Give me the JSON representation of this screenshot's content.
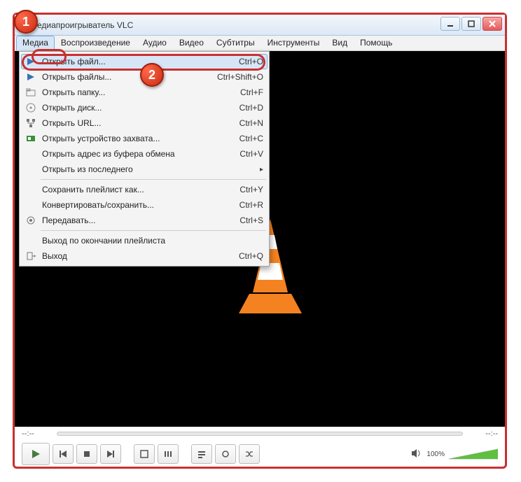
{
  "window": {
    "title": "едиапроигрыватель VLC"
  },
  "badges": {
    "one": "1",
    "two": "2"
  },
  "menubar": {
    "items": [
      "Медиа",
      "Воспроизведение",
      "Аудио",
      "Видео",
      "Субтитры",
      "Инструменты",
      "Вид",
      "Помощь"
    ]
  },
  "dropdown": {
    "items": [
      {
        "icon": "play-file-icon",
        "label": "Открыть файл...",
        "shortcut": "Ctrl+O",
        "highlight": true
      },
      {
        "icon": "play-multi-icon",
        "label": "Открыть файлы...",
        "shortcut": "Ctrl+Shift+O"
      },
      {
        "icon": "folder-icon",
        "label": "Открыть папку...",
        "shortcut": "Ctrl+F"
      },
      {
        "icon": "disc-icon",
        "label": "Открыть диск...",
        "shortcut": "Ctrl+D"
      },
      {
        "icon": "network-icon",
        "label": "Открыть URL...",
        "shortcut": "Ctrl+N"
      },
      {
        "icon": "capture-icon",
        "label": "Открыть устройство захвата...",
        "shortcut": "Ctrl+C"
      },
      {
        "icon": "clipboard-icon",
        "label": "Открыть адрес из буфера обмена",
        "shortcut": "Ctrl+V"
      },
      {
        "icon": "recent-icon",
        "label": "Открыть из последнего",
        "shortcut": "",
        "submenu": true
      },
      {
        "sep": true
      },
      {
        "icon": "save-icon",
        "label": "Сохранить плейлист как...",
        "shortcut": "Ctrl+Y"
      },
      {
        "icon": "convert-icon",
        "label": "Конвертировать/сохранить...",
        "shortcut": "Ctrl+R"
      },
      {
        "icon": "stream-icon",
        "label": "Передавать...",
        "shortcut": "Ctrl+S"
      },
      {
        "sep": true
      },
      {
        "icon": "quit-end-icon",
        "label": "Выход по окончании плейлиста",
        "shortcut": ""
      },
      {
        "icon": "exit-icon",
        "label": "Выход",
        "shortcut": "Ctrl+Q"
      }
    ]
  },
  "playback": {
    "time_start": "--:--",
    "time_end": "--:--",
    "volume_label": "100%"
  },
  "colors": {
    "highlight_ring": "#c83030",
    "menu_hover": "#d7e6f7"
  }
}
